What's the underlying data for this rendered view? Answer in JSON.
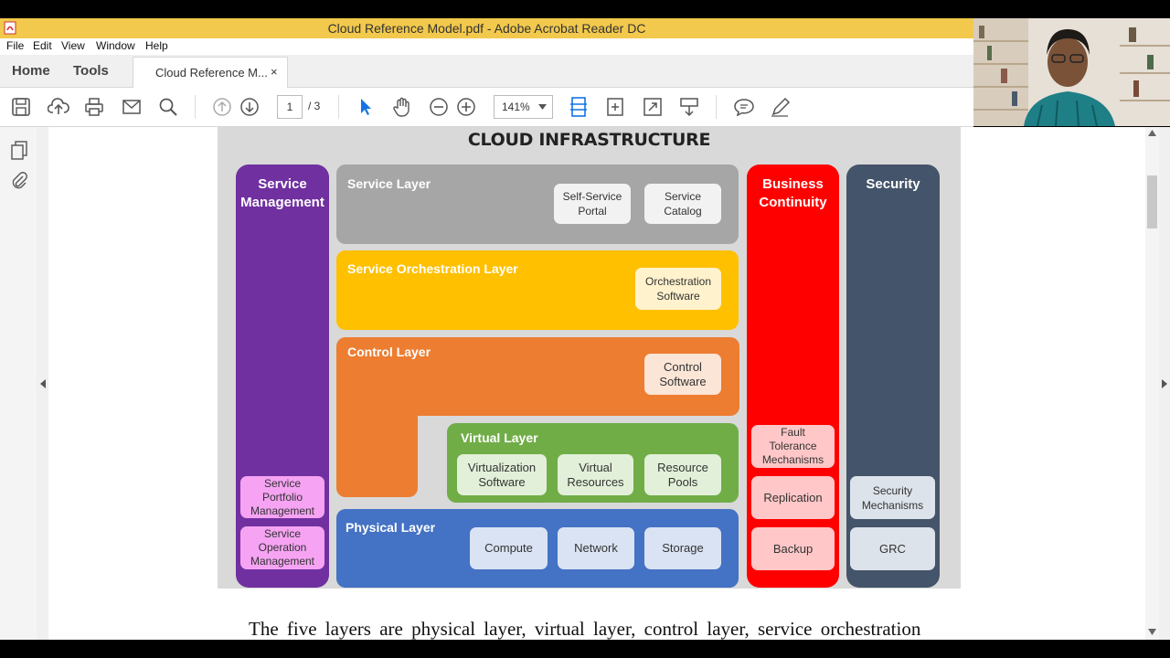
{
  "window": {
    "title": "Cloud Reference Model.pdf - Adobe Acrobat Reader DC"
  },
  "menu": {
    "items": [
      "File",
      "Edit",
      "View",
      "Window",
      "Help"
    ]
  },
  "tabs": {
    "home": "Home",
    "tools": "Tools",
    "document": "Cloud Reference M...",
    "close": "×"
  },
  "toolbar": {
    "page_current": "1",
    "page_total": "/ 3",
    "zoom": "141%"
  },
  "diagram": {
    "title": "CLOUD INFRASTRUCTURE",
    "service_management": {
      "title_line1": "Service",
      "title_line2": "Management",
      "items": [
        [
          "Service",
          "Portfolio",
          "Management"
        ],
        [
          "Service",
          "Operation",
          "Management"
        ]
      ]
    },
    "service_layer": {
      "title": "Service Layer",
      "items": [
        [
          "Self-Service",
          "Portal"
        ],
        [
          "Service",
          "Catalog"
        ]
      ]
    },
    "orchestration_layer": {
      "title": "Service Orchestration Layer",
      "items": [
        [
          "Orchestration",
          "Software"
        ]
      ]
    },
    "control_layer": {
      "title": "Control Layer",
      "items": [
        [
          "Control",
          "Software"
        ]
      ]
    },
    "virtual_layer": {
      "title": "Virtual Layer",
      "items": [
        [
          "Virtualization",
          "Software"
        ],
        [
          "Virtual",
          "Resources"
        ],
        [
          "Resource",
          "Pools"
        ]
      ]
    },
    "physical_layer": {
      "title": "Physical Layer",
      "items": [
        "Compute",
        "Network",
        "Storage"
      ]
    },
    "business_continuity": {
      "title_line1": "Business",
      "title_line2": "Continuity",
      "items": [
        [
          "Fault",
          "Tolerance",
          "Mechanisms"
        ],
        [
          "Replication"
        ],
        [
          "Backup"
        ]
      ]
    },
    "security": {
      "title": "Security",
      "items": [
        [
          "Security",
          "Mechanisms"
        ],
        [
          "GRC"
        ]
      ]
    }
  },
  "document_text": "The five layers are physical layer, virtual layer, control layer, service orchestration",
  "colors": {
    "purple": "#7030a0",
    "gray_layer": "#a6a6a6",
    "yellow": "#ffc000",
    "orange": "#ed7d31",
    "green": "#70ad47",
    "blue": "#4472c4",
    "red": "#ff0000",
    "slate": "#44546a",
    "titlebar": "#f2c94c",
    "acrobat_blue": "#1473e6"
  },
  "icons": [
    "save-icon",
    "upload-icon",
    "print-icon",
    "email-icon",
    "search-icon",
    "page-up-icon",
    "page-down-icon",
    "select-arrow-icon",
    "hand-icon",
    "zoom-out-icon",
    "zoom-in-icon",
    "fit-width-icon",
    "rotate-icon",
    "fullscreen-icon",
    "scroll-mode-icon",
    "comment-icon",
    "sign-icon",
    "pages-panel-icon",
    "attachments-icon"
  ]
}
